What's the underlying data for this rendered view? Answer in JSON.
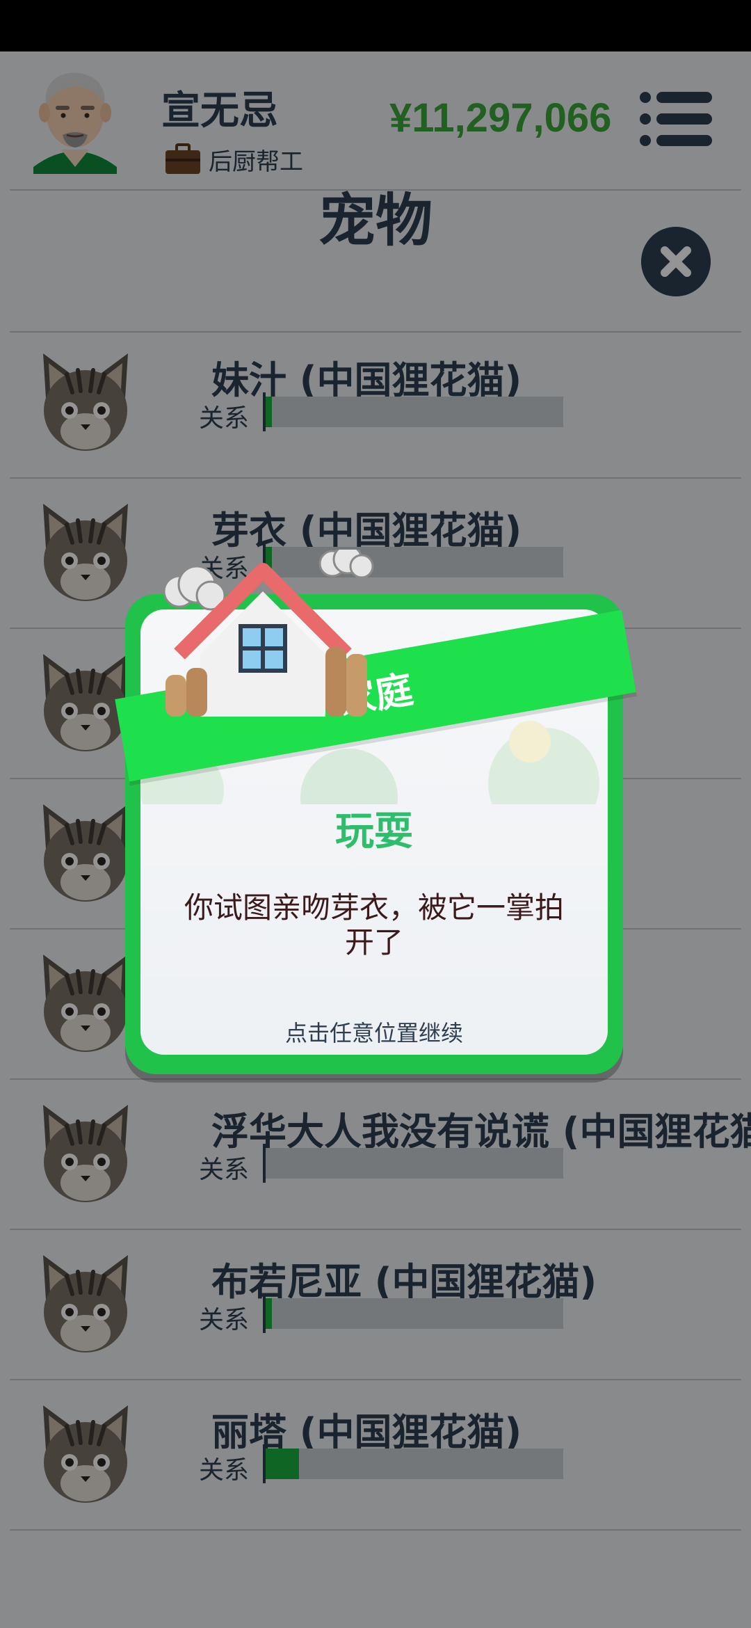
{
  "header": {
    "player_name": "宣无忌",
    "job": "后厨帮工",
    "money": "¥11,297,066"
  },
  "page": {
    "title": "宠物"
  },
  "pets": [
    {
      "name": "妹汁 (中国狸花猫)",
      "relation_label": "关系",
      "relation_level": 0.03
    },
    {
      "name": "芽衣 (中国狸花猫)",
      "relation_label": "关系",
      "relation_level": 0.03
    },
    {
      "name": "",
      "relation_label": "",
      "relation_level": 0.03
    },
    {
      "name": "",
      "relation_label": "",
      "relation_level": 0.03
    },
    {
      "name": "",
      "relation_label": "",
      "relation_level": 0.03
    },
    {
      "name": "浮华大人我没有说谎 (中国狸花猫",
      "relation_label": "关系",
      "relation_level": 0.0
    },
    {
      "name": "布若尼亚 (中国狸花猫)",
      "relation_label": "关系",
      "relation_level": 0.03
    },
    {
      "name": "丽塔 (中国狸花猫)",
      "relation_label": "关系",
      "relation_level": 0.12
    }
  ],
  "dialog": {
    "banner": "家庭",
    "title": "玩耍",
    "message": "你试图亲吻芽衣，被它一掌拍开了",
    "hint": "点击任意位置继续"
  },
  "colors": {
    "accent_green": "#21c24a",
    "money_green": "#3ba53a",
    "navy": "#2d3e50"
  }
}
